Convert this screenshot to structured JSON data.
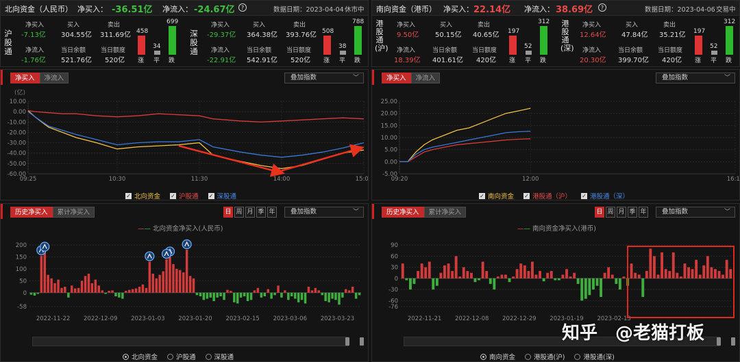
{
  "north": {
    "title": "北向资金（人民币）",
    "net_buy_label": "净买入：",
    "net_buy": "-36.51亿",
    "net_flow_label": "净流入：",
    "net_flow": "-24.67亿",
    "help": "?",
    "date": "数据日期：2023-04-04",
    "status": "休市中",
    "sh": {
      "label": "沪股通",
      "net_buy_label": "净买入",
      "net_buy": "-7.13亿",
      "buy_label": "买入",
      "buy": "304.55亿",
      "sell_label": "卖出",
      "sell": "311.69亿",
      "net_flow_label": "净流入",
      "net_flow": "-1.76亿",
      "balance_label": "当日余额",
      "balance": "521.76亿",
      "quota_label": "当日额度",
      "quota": "520亿",
      "up": "458",
      "flat": "34",
      "down": "699",
      "up_label": "涨",
      "flat_label": "平",
      "down_label": "跌"
    },
    "sz": {
      "label": "深股通",
      "net_buy_label": "净买入",
      "net_buy": "-29.37亿",
      "buy_label": "买入",
      "buy": "364.38亿",
      "sell_label": "卖出",
      "sell": "393.76亿",
      "net_flow_label": "净流入",
      "net_flow": "-22.91亿",
      "balance_label": "当日余额",
      "balance": "542.91亿",
      "quota_label": "当日额度",
      "quota": "520亿",
      "up": "508",
      "flat": "38",
      "down": "788",
      "up_label": "涨",
      "flat_label": "平",
      "down_label": "跌"
    }
  },
  "south": {
    "title": "南向资金（港币）",
    "net_buy_label": "净买入：",
    "net_buy": "22.14亿",
    "net_flow_label": "净流入：",
    "net_flow": "38.69亿",
    "help": "?",
    "date": "数据日期：2023-04-06",
    "status": "交易中",
    "sh": {
      "label": "港股通(沪)",
      "net_buy_label": "净买入",
      "net_buy": "9.50亿",
      "buy_label": "买入",
      "buy": "50.15亿",
      "sell_label": "卖出",
      "sell": "40.65亿",
      "net_flow_label": "净流入",
      "net_flow": "18.39亿",
      "balance_label": "当日余额",
      "balance": "401.61亿",
      "quota_label": "当日额度",
      "quota": "420亿",
      "up": "197",
      "flat": "52",
      "down": "312",
      "up_label": "涨",
      "flat_label": "平",
      "down_label": "跌"
    },
    "sz": {
      "label": "港股通(深)",
      "net_buy_label": "净买入",
      "net_buy": "12.64亿",
      "buy_label": "买入",
      "buy": "47.84亿",
      "sell_label": "卖出",
      "sell": "35.21亿",
      "net_flow_label": "净流入",
      "net_flow": "20.30亿",
      "balance_label": "当日余额",
      "balance": "399.70亿",
      "quota_label": "当日额度",
      "quota": "420亿",
      "up": "197",
      "flat": "52",
      "down": "312",
      "up_label": "涨",
      "flat_label": "平",
      "down_label": "跌"
    }
  },
  "intraday_north": {
    "tab_active": "净买入",
    "tab_other": "净流入",
    "overlay": "叠加指数",
    "unit": "(亿)",
    "legend": [
      "北向资金",
      "沪股通",
      "深股通"
    ]
  },
  "intraday_south": {
    "tab_active": "净买入",
    "tab_other": "净流入",
    "overlay": "叠加指数",
    "legend": [
      "南向资金",
      "港股通（沪）",
      "港股通（深）"
    ]
  },
  "hist_north": {
    "tab_active": "历史净买入",
    "tab_other": "累计净买入",
    "periods": [
      "日",
      "周",
      "月",
      "季",
      "年"
    ],
    "overlay": "叠加指数",
    "series_label": "北向资金净买入(人民币)",
    "radios": [
      "北向资金",
      "沪股通",
      "深股通"
    ]
  },
  "hist_south": {
    "tab_active": "历史净买入",
    "tab_other": "累计净买入",
    "periods": [
      "日",
      "周",
      "月",
      "季",
      "年"
    ],
    "overlay": "叠加指数",
    "series_label": "南向资金净买入(港币)",
    "radios": [
      "南向资金",
      "港股通(沪)",
      "港股通(深)"
    ]
  },
  "watermark": {
    "left": "知乎",
    "right": "@老猫打板"
  },
  "colors": {
    "north": "#f2c144",
    "sh": "#d93a3a",
    "sz": "#3a78d8",
    "pos": "#d23b3b",
    "neg": "#3fae3f",
    "arrow": "#e8321e"
  },
  "chart_data": [
    {
      "type": "line",
      "title": "",
      "xticks": [
        "09:25",
        "10:30",
        "11:30",
        "14:00",
        "15:00"
      ],
      "ylim": [
        -60,
        10
      ],
      "yticks": [
        10,
        0,
        -10,
        -20,
        -30,
        -40,
        -50,
        -60
      ],
      "x": [
        "09:25",
        "09:30",
        "09:40",
        "09:50",
        "10:00",
        "10:15",
        "10:30",
        "10:45",
        "11:00",
        "11:15",
        "11:30",
        "13:10",
        "13:30",
        "13:45",
        "14:00",
        "14:15",
        "14:30",
        "14:45",
        "15:00"
      ],
      "series": [
        {
          "name": "北向资金",
          "values": [
            1,
            -5,
            -15,
            -20,
            -25,
            -30,
            -36,
            -34,
            -33,
            -32,
            -30,
            -42,
            -48,
            -52,
            -55,
            -52,
            -46,
            -40,
            -37
          ]
        },
        {
          "name": "沪股通",
          "values": [
            1,
            0,
            -1,
            -2,
            -2,
            -4,
            -5,
            -4,
            -2,
            -3,
            -4,
            -7,
            -9,
            -10,
            -9,
            -8,
            -7,
            -6,
            -7
          ]
        },
        {
          "name": "深股通",
          "values": [
            0,
            -5,
            -14,
            -18,
            -22,
            -27,
            -32,
            -30,
            -29,
            -29,
            -27,
            -34,
            -39,
            -42,
            -44,
            -42,
            -39,
            -35,
            -30
          ]
        }
      ]
    },
    {
      "type": "line",
      "title": "",
      "xticks": [
        "09:20",
        "12:00",
        "16:10"
      ],
      "ylim": [
        -5,
        25
      ],
      "yticks": [
        25,
        20,
        15,
        10,
        5,
        0,
        -5
      ],
      "x": [
        "09:20",
        "09:30",
        "09:40",
        "09:50",
        "10:00",
        "10:15",
        "10:30",
        "10:45",
        "11:00",
        "11:15",
        "11:30",
        "11:45",
        "12:00"
      ],
      "series": [
        {
          "name": "南向资金",
          "values": [
            0,
            0,
            4,
            7,
            9,
            11,
            13,
            14,
            16,
            18,
            20,
            21,
            22.1
          ]
        },
        {
          "name": "港股通（沪）",
          "values": [
            0,
            0,
            2,
            4,
            5,
            6,
            7,
            7.5,
            8,
            8.5,
            9,
            9.3,
            9.5
          ]
        },
        {
          "name": "港股通（深）",
          "values": [
            0,
            0,
            3,
            5,
            6,
            7,
            8,
            9,
            10,
            11,
            12,
            12.4,
            12.6
          ]
        }
      ]
    },
    {
      "type": "bar",
      "title": "",
      "ylim": [
        -58,
        200
      ],
      "yticks": [
        200,
        150,
        100,
        50,
        0,
        -58
      ],
      "xticks": [
        "2022-11-22",
        "2022-12-09",
        "2023-01-03",
        "2023-01-20",
        "2023-02-15",
        "2023-03-06",
        "2023-03-23"
      ],
      "values": [
        -8,
        -12,
        -5,
        155,
        170,
        75,
        60,
        40,
        55,
        20,
        25,
        -20,
        30,
        18,
        20,
        50,
        70,
        80,
        40,
        55,
        30,
        10,
        -5,
        8,
        10,
        -15,
        -20,
        -25,
        8,
        12,
        15,
        18,
        25,
        35,
        20,
        130,
        80,
        60,
        75,
        90,
        140,
        150,
        120,
        100,
        95,
        85,
        180,
        70,
        60,
        -10,
        -15,
        -30,
        -25,
        -20,
        -35,
        -20,
        -15,
        -30,
        12,
        8,
        -40,
        -45,
        -20,
        -15,
        -35,
        -30,
        10,
        20,
        -20,
        -15,
        15,
        -25,
        -10,
        30,
        -20,
        10,
        -30,
        -15,
        -25,
        -40,
        -30,
        -45,
        25,
        10,
        20,
        10,
        -10,
        -35,
        -40,
        -25,
        -30,
        -50,
        -20,
        15,
        10,
        25,
        -25,
        -10
      ]
    },
    {
      "type": "bar",
      "title": "",
      "ylim": [
        -76,
        90
      ],
      "yticks": [
        90,
        60,
        30,
        0,
        -30,
        -60,
        -76
      ],
      "xticks": [
        "2022-11-21",
        "2022-12-08",
        "2022-12-29",
        "2023-01-19",
        "2023-02-13"
      ],
      "values": [
        40,
        -5,
        -30,
        -15,
        20,
        40,
        30,
        45,
        -30,
        -20,
        15,
        35,
        40,
        20,
        60,
        5,
        30,
        20,
        15,
        -10,
        -5,
        45,
        20,
        -15,
        -30,
        5,
        10,
        10,
        -10,
        5,
        25,
        40,
        35,
        20,
        45,
        10,
        20,
        -8,
        15,
        20,
        -5,
        -5,
        10,
        25,
        5,
        15,
        -15,
        -60,
        -55,
        -45,
        -30,
        -20,
        -50,
        15,
        30,
        10,
        -15,
        -30,
        5,
        -20,
        40,
        15,
        10,
        -50,
        20,
        80,
        60,
        10,
        70,
        25,
        20,
        70,
        15,
        5,
        40,
        30,
        25,
        50,
        10,
        35,
        60,
        30,
        25,
        20,
        10,
        50,
        25
      ]
    }
  ]
}
